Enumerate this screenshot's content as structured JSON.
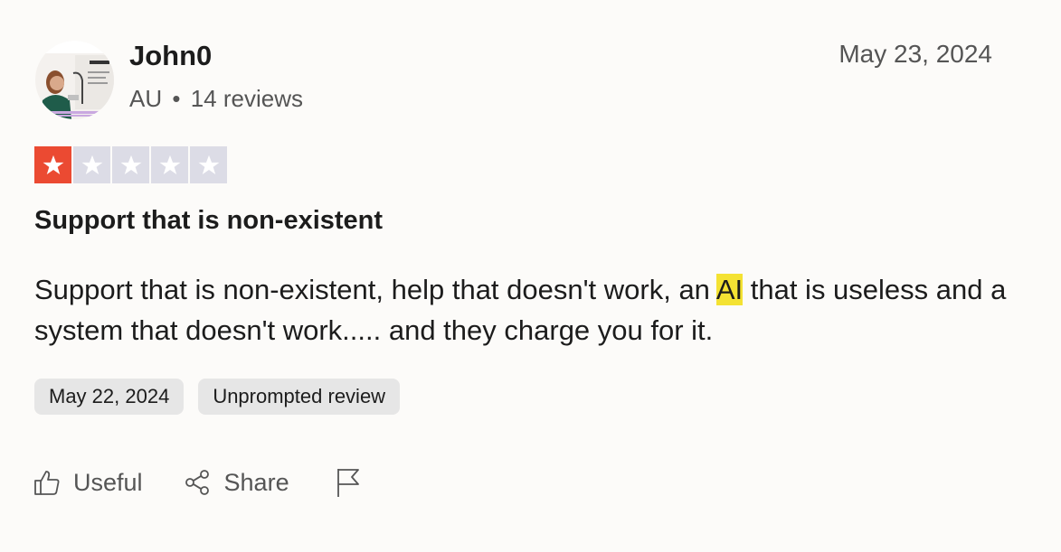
{
  "reviewer": {
    "name": "John0",
    "country": "AU",
    "separator": "•",
    "review_count": "14 reviews",
    "avatar": "avatar-photo-icon"
  },
  "review": {
    "posted_date": "May 23, 2024",
    "rating": 1,
    "rating_max": 5,
    "title": "Support that is non-existent",
    "body_before": "Support that is non-existent, help that doesn't work, an ",
    "body_highlight": "AI",
    "body_after": " that is useless and a system that doesn't work..... and they charge you for it.",
    "experience_date": "May 22, 2024",
    "review_type": "Unprompted review"
  },
  "actions": {
    "useful_label": "Useful",
    "share_label": "Share",
    "useful_icon": "thumbs-up-icon",
    "share_icon": "share-icon",
    "flag_icon": "flag-icon"
  },
  "colors": {
    "star_on": "#eb4a32",
    "star_off": "#dcdce6",
    "highlight": "#f4e233",
    "tag_bg": "#e6e6e6"
  }
}
